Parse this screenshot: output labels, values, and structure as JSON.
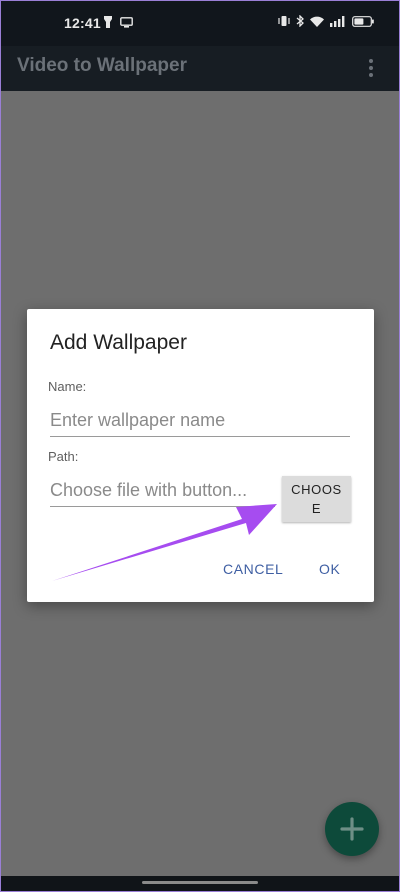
{
  "status_bar": {
    "time": "12:41",
    "left_icons": [
      "flashlight-icon",
      "cast-icon"
    ],
    "right_icons": [
      "vibrate-icon",
      "bluetooth-icon",
      "wifi-icon",
      "signal-icon",
      "battery-icon"
    ]
  },
  "app_bar": {
    "title": "Video to Wallpaper",
    "menu_icon": "overflow-menu-icon"
  },
  "dialog": {
    "title": "Add Wallpaper",
    "name_label": "Name:",
    "name_placeholder": "Enter wallpaper name",
    "name_value": "",
    "path_label": "Path:",
    "path_placeholder": "Choose file with button...",
    "path_value": "",
    "choose_label": "CHOOSE",
    "cancel_label": "CANCEL",
    "ok_label": "OK"
  },
  "fab": {
    "icon": "plus-icon"
  },
  "colors": {
    "accent": "#3f5fa3",
    "fab": "#0d4a3a",
    "annotation_arrow": "#a64cf0",
    "scrim": "#6e6e6e"
  }
}
